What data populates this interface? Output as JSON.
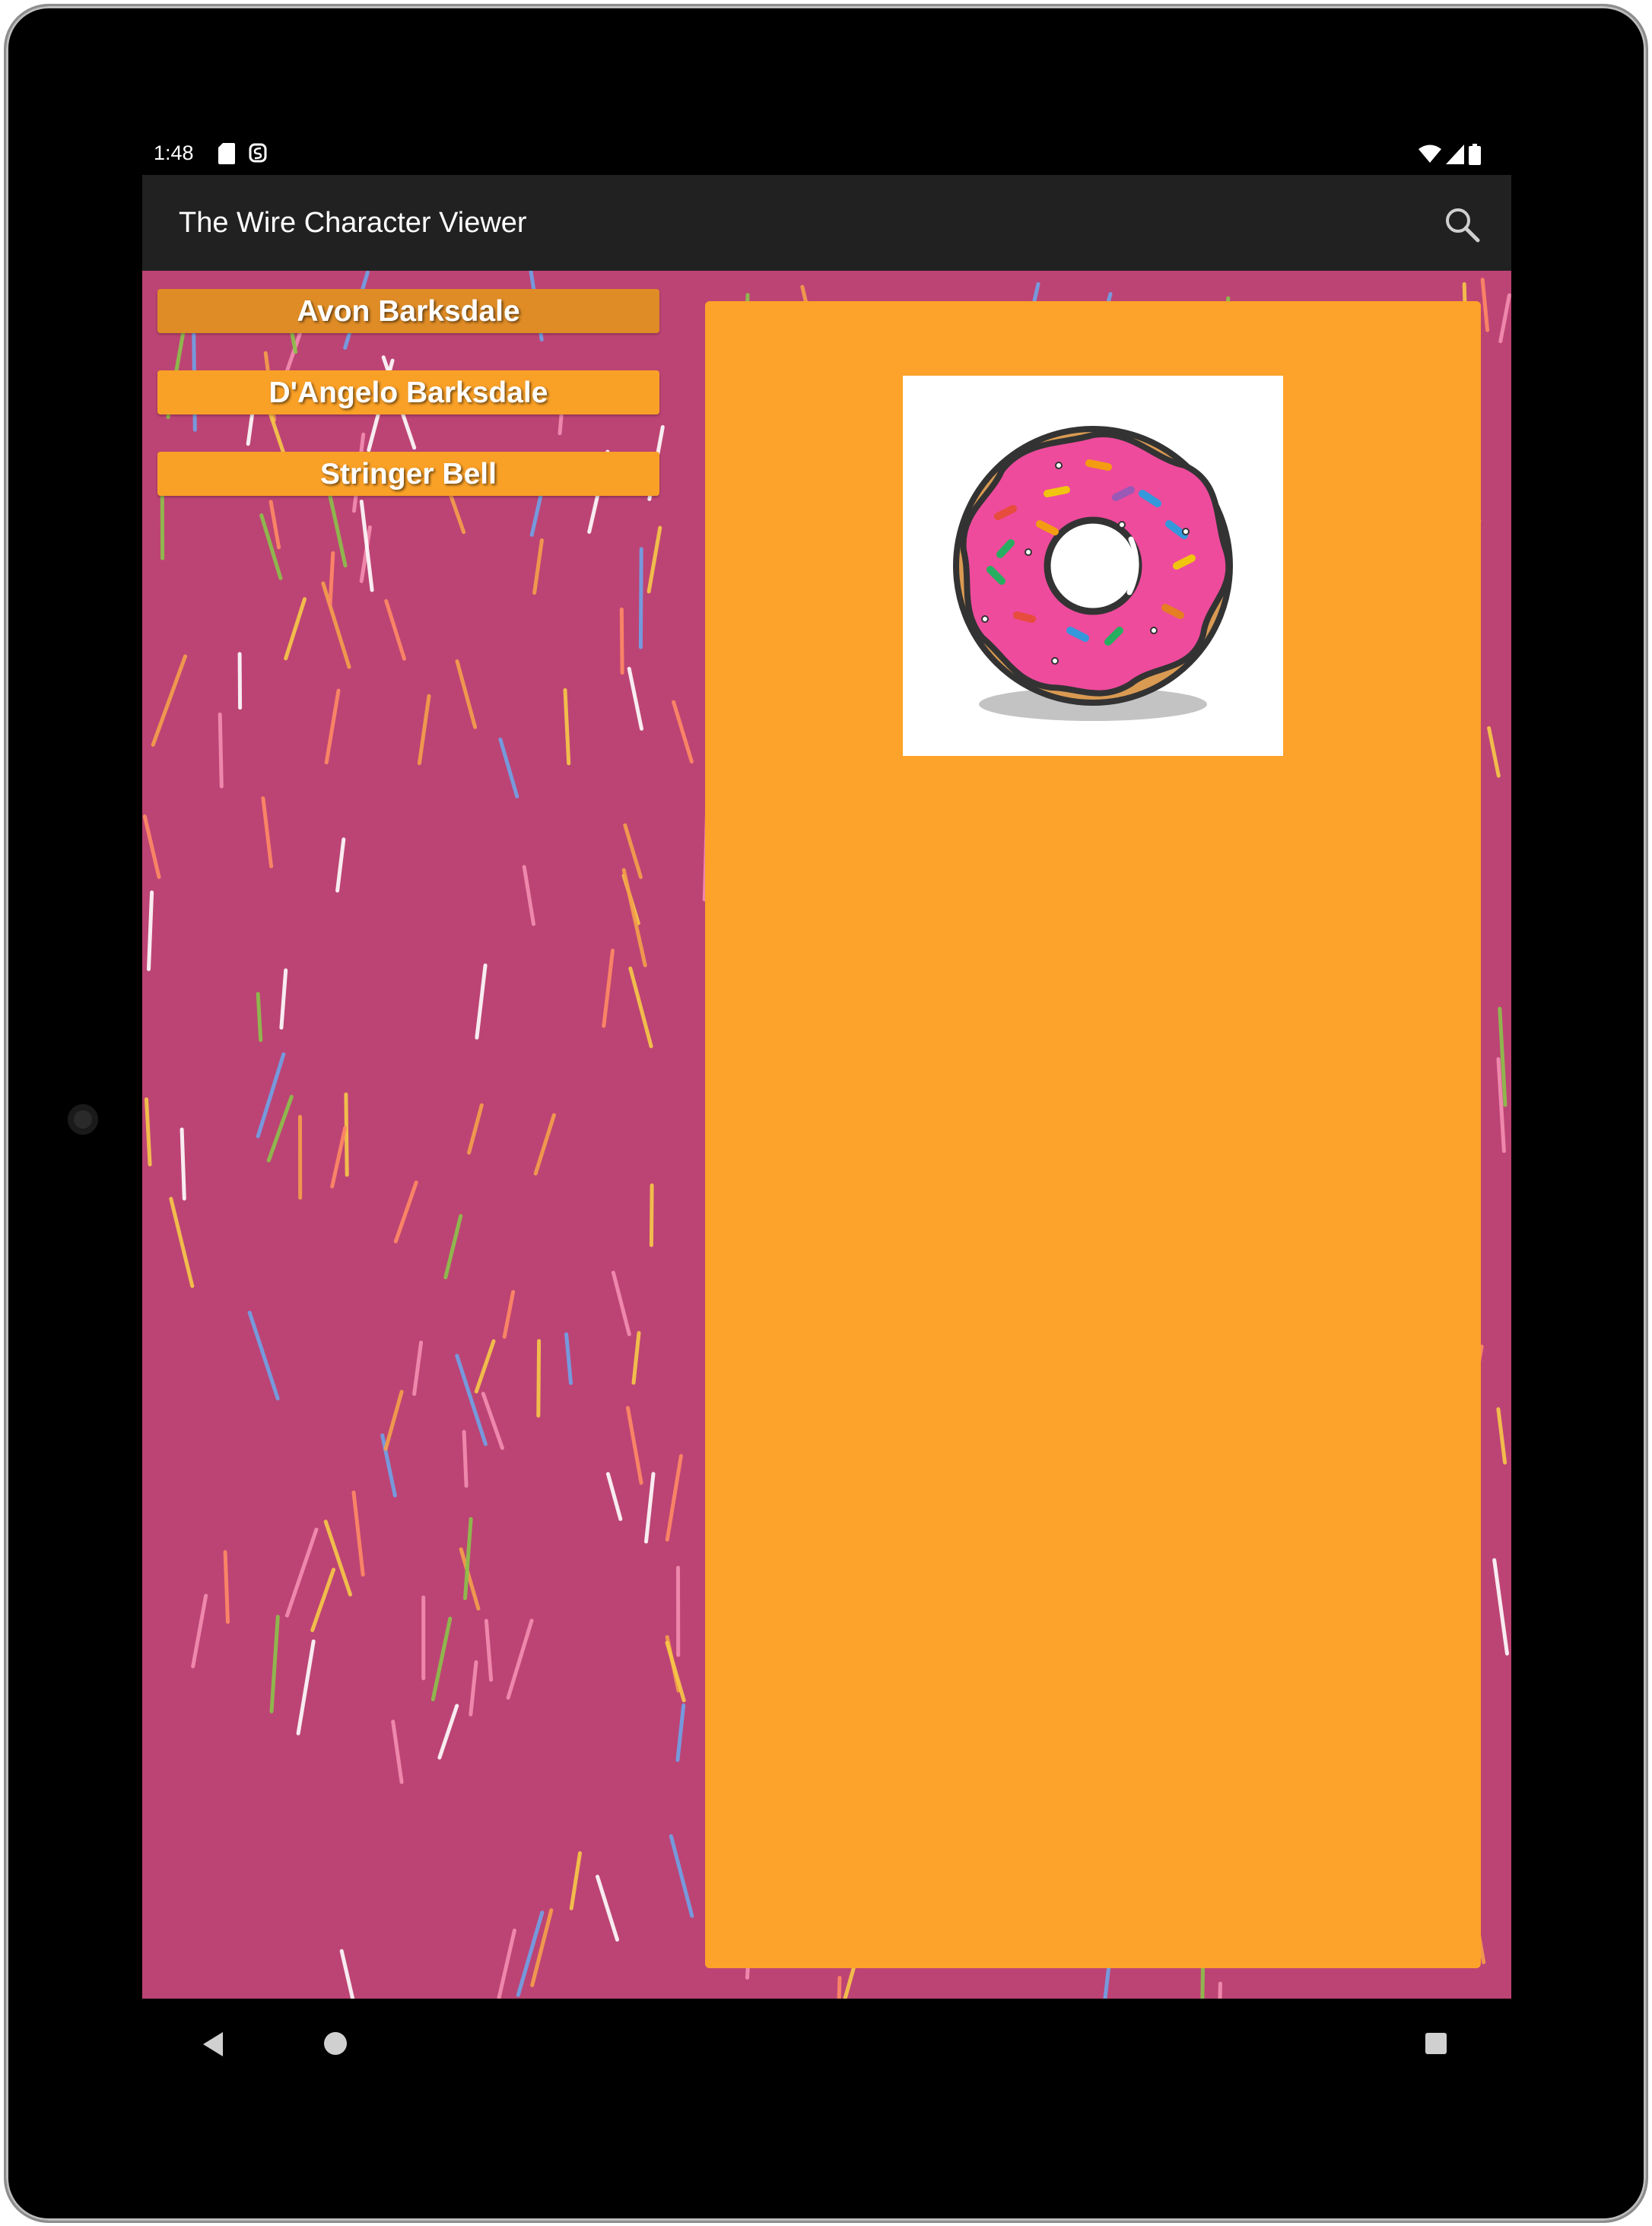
{
  "status_bar": {
    "time": "1:48",
    "notification_icons": [
      "sd-card-icon",
      "s-logo-icon"
    ],
    "system_icons": [
      "wifi-icon",
      "cell-signal-icon",
      "battery-icon"
    ]
  },
  "app_bar": {
    "title": "The Wire Character Viewer",
    "action_icon": "search-icon"
  },
  "characters": [
    {
      "label": "Avon Barksdale",
      "selected": true
    },
    {
      "label": "D'Angelo Barksdale",
      "selected": false
    },
    {
      "label": "Stringer Bell",
      "selected": false
    }
  ],
  "detail": {
    "image_icon": "donut-icon"
  },
  "colors": {
    "background": "#bc4474",
    "button": "#f9a027",
    "button_selected": "#df8c26",
    "detail_panel": "#fda22a",
    "app_bar": "#212121"
  },
  "nav_bar": {
    "icons": [
      "back-icon",
      "home-icon",
      "recents-icon"
    ]
  }
}
